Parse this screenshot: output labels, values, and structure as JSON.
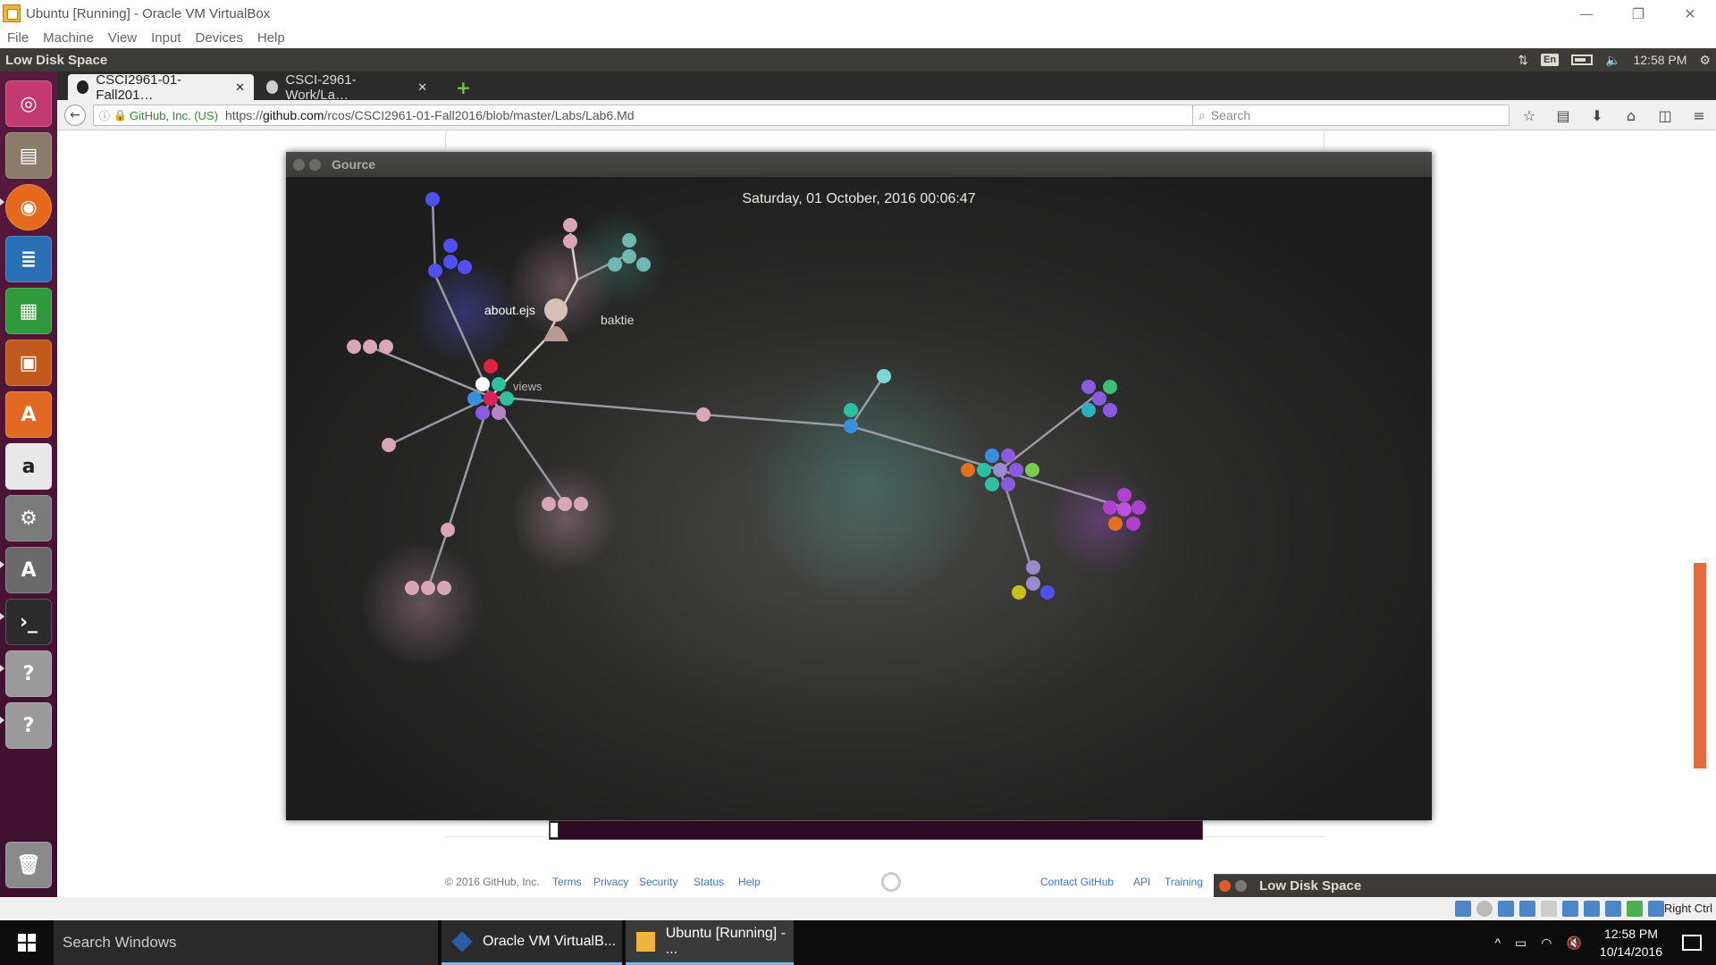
{
  "host_window": {
    "title": "Ubuntu [Running] - Oracle VM VirtualBox",
    "controls": [
      "—",
      "❐",
      "✕"
    ],
    "menu": [
      "File",
      "Machine",
      "View",
      "Input",
      "Devices",
      "Help"
    ]
  },
  "ubuntu_panel": {
    "title": "Low Disk Space",
    "keyboard": "En",
    "time": "12:58 PM"
  },
  "launcher": {
    "items": [
      "dash-home",
      "files",
      "firefox",
      "writer",
      "calc",
      "impress",
      "software-center",
      "amazon",
      "system-settings",
      "software-updater",
      "terminal",
      "unknown-app",
      "unknown-app",
      "trash"
    ]
  },
  "browser": {
    "tabs": [
      {
        "label": "CSCI2961-01-Fall201…",
        "active": true
      },
      {
        "label": "CSCI-2961-Work/La…",
        "active": false
      }
    ],
    "url_identity": "GitHub, Inc. (US)",
    "url_prefix": "https://",
    "url_host": "github.com",
    "url_path": "/rcos/CSCI2961-01-Fall2016/blob/master/Labs/Lab6.Md",
    "search_placeholder": "Search"
  },
  "gource": {
    "window_title": "Gource",
    "date": "Saturday, 01 October, 2016 00:06:47",
    "labels": {
      "about": "about.ejs",
      "user": "baktie",
      "views": "views"
    }
  },
  "github_footer": {
    "copyright": "© 2016 GitHub, Inc.",
    "links_left": [
      "Terms",
      "Privacy",
      "Security",
      "Status",
      "Help"
    ],
    "links_right": [
      "Contact GitHub",
      "API",
      "Training"
    ]
  },
  "notification": {
    "title": "Low Disk Space"
  },
  "vb_status": {
    "host_key": "Right Ctrl"
  },
  "taskbar": {
    "search": "Search Windows",
    "apps": [
      "Oracle VM VirtualB...",
      "Ubuntu [Running] - ..."
    ],
    "time": "12:58 PM",
    "date": "10/14/2016"
  },
  "colors": {
    "launcher": "#4a1233",
    "ubuntu_panel": "#3c3b37",
    "notification_close": "#e05a2a",
    "taskbar_accent": "#76b9ed"
  }
}
